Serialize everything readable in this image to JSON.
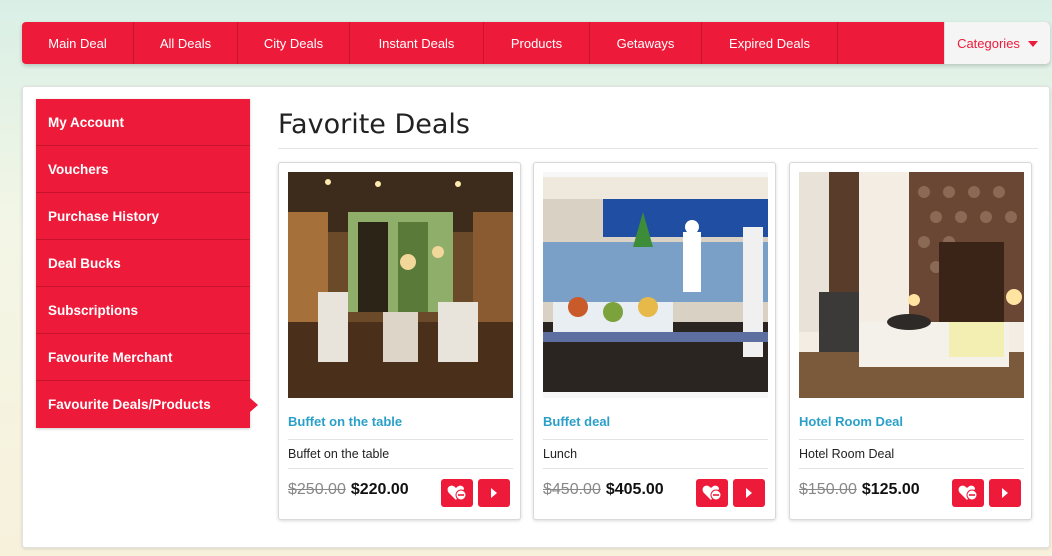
{
  "topnav": {
    "items": [
      "Main Deal",
      "All Deals",
      "City Deals",
      "Instant Deals",
      "Products",
      "Getaways",
      "Expired Deals"
    ],
    "categories_label": "Categories"
  },
  "sidebar": {
    "items": [
      {
        "label": "My Account"
      },
      {
        "label": "Vouchers"
      },
      {
        "label": "Purchase History"
      },
      {
        "label": "Deal Bucks"
      },
      {
        "label": "Subscriptions"
      },
      {
        "label": "Favourite Merchant"
      },
      {
        "label": "Favourite Deals/Products",
        "active": true
      }
    ]
  },
  "main": {
    "title": "Favorite Deals",
    "deals": [
      {
        "title": "Buffet on the table",
        "subtitle": "Buffet on the table",
        "old_price": "$250.00",
        "new_price": "$220.00",
        "image": "restaurant-interior"
      },
      {
        "title": "Buffet deal",
        "subtitle": "Lunch",
        "old_price": "$450.00",
        "new_price": "$405.00",
        "image": "buffet-counter"
      },
      {
        "title": "Hotel Room Deal",
        "subtitle": "Hotel Room Deal",
        "old_price": "$150.00",
        "new_price": "$125.00",
        "image": "hotel-room"
      }
    ]
  },
  "colors": {
    "brand": "#ee1a3a",
    "link": "#2aa0c9"
  },
  "icons": {
    "remove": "heart-remove-icon",
    "go": "play-arrow-icon",
    "dropdown": "caret-down-icon"
  }
}
